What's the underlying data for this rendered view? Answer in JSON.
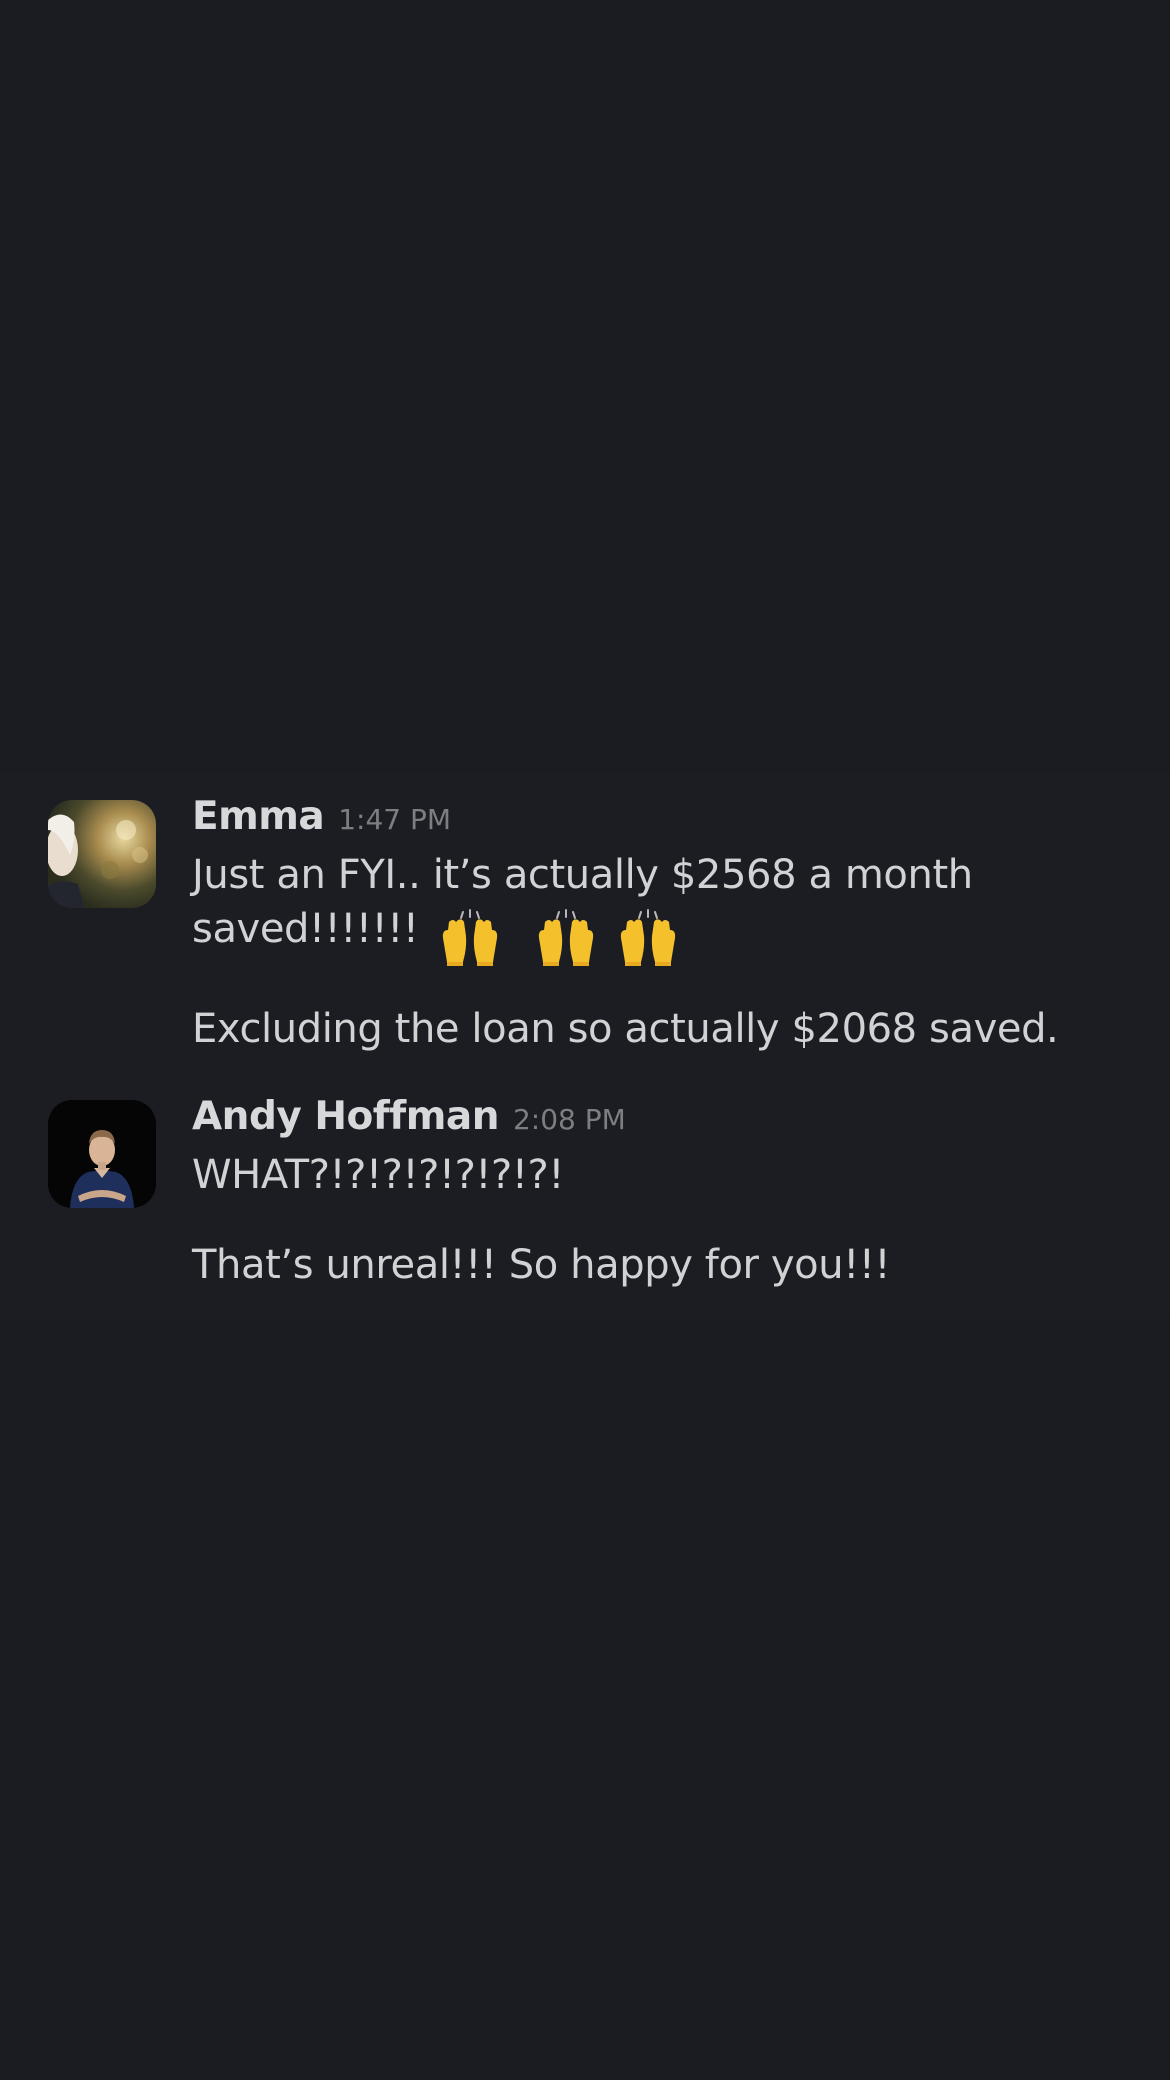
{
  "messages": [
    {
      "author": "Emma",
      "time": "1:47 PM",
      "lines": [
        "Just an FYI.. it’s actually $2568 a month",
        "saved!!!!!!!"
      ],
      "emoji": [
        "raising-hands-emoji",
        "raising-hands-emoji",
        "raising-hands-emoji"
      ],
      "followup": "Excluding the loan so actually $2068 saved."
    },
    {
      "author": "Andy Hoffman",
      "time": "2:08 PM",
      "line": "WHAT?!?!?!?!?!?!?!",
      "followup": "That’s unreal!!! So happy for you!!!"
    }
  ],
  "colors": {
    "background": "#1a1c22",
    "text": "#d1d2d3",
    "timestamp": "#7c7e82",
    "emoji": "#f4c02b"
  }
}
